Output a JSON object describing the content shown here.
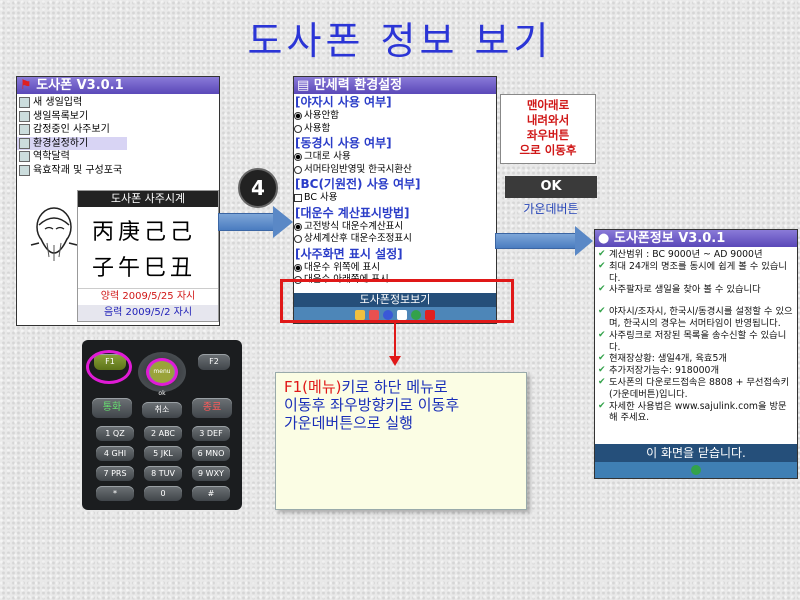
{
  "title": "도사폰 정보 보기",
  "step_number": "4",
  "screen1": {
    "titlebar": "도사폰 V3.0.1",
    "menu": [
      "새 생일입력",
      "생일목록보기",
      "감정중인 사주보기",
      "환경설정하기",
      "역학달력",
      "육효작괘 및 구성포국"
    ],
    "clock_title": "도사폰 사주시계",
    "saju_top": [
      "丙",
      "庚",
      "己",
      "己"
    ],
    "saju_bottom": [
      "子",
      "午",
      "巳",
      "丑"
    ],
    "solar": "양력 2009/5/25 자시",
    "lunar": "음력 2009/5/2 자시"
  },
  "screen2": {
    "titlebar": "만세력 환경설정",
    "sections": [
      {
        "header": "[야자시 사용 여부]",
        "options": [
          {
            "label": "사용안함",
            "type": "radio",
            "checked": true
          },
          {
            "label": "사용함",
            "type": "radio",
            "checked": false
          }
        ]
      },
      {
        "header": "[동경시 사용 여부]",
        "options": [
          {
            "label": "그대로 사용",
            "type": "radio",
            "checked": true
          },
          {
            "label": "서머타임반영및 한국시환산",
            "type": "radio",
            "checked": false
          }
        ]
      },
      {
        "header": "[BC(기원전) 사용 여부]",
        "options": [
          {
            "label": "BC 사용",
            "type": "check",
            "checked": false
          }
        ]
      },
      {
        "header": "[대운수 계산표시방법]",
        "options": [
          {
            "label": "고전방식 대운수계산표시",
            "type": "radio",
            "checked": true
          },
          {
            "label": "상세계산후 대운수조정표시",
            "type": "radio",
            "checked": false
          }
        ]
      },
      {
        "header": "[사주화면 표시 설정]",
        "options": [
          {
            "label": "대운수 위쪽에 표시",
            "type": "radio",
            "checked": true
          },
          {
            "label": "대운수 아래쪽에 표시",
            "type": "radio",
            "checked": false
          }
        ]
      }
    ],
    "bottom_menu": "도사폰정보보기"
  },
  "note_red": [
    "맨아래로",
    "내려와서",
    "좌우버튼",
    "으로 이동후"
  ],
  "ok_label": "OK",
  "ok_caption": "가운데버튼",
  "screen3": {
    "titlebar": "도사폰정보 V3.0.1",
    "items": [
      "계산범위 : BC 9000년 ~ AD 9000년",
      "최대 24개의 명조를 동시에 쉽게 볼 수 있습니다.",
      "사주팔자로 생일을 찾아 볼 수 있습니다",
      "",
      "야자시/조자시, 한국시/동경시를 설정할 수 있으며, 한국시의 경우는 서머타임이 반영됩니다.",
      "사주링크로 저장된 목록을 송수신할 수 있습니다.",
      "현재장상황: 생일4개, 육효5개",
      "추가저장가능수: 918000개",
      "도사폰의 다운로드접속은 8808 + 무선접속키(가운데버튼)입니다.",
      "자세한 사용법은 www.sajulink.com을 방문해 주세요."
    ],
    "close_button": "이 화면을 닫습니다."
  },
  "callout": {
    "line1_red": "F1(메뉴)",
    "line1_rest": "키로 하단 메뉴로",
    "line2": "이동후 좌우방향키로 이동후",
    "line3": "가운데버튼으로 실행"
  },
  "keypad": {
    "f1": "F1",
    "f2": "F2",
    "menu_ok": "menu ok",
    "call": "통화",
    "cancel": "취소",
    "end": "종료",
    "keys": [
      [
        "1 QZ",
        "2 ABC",
        "3 DEF"
      ],
      [
        "4 GHI",
        "5 JKL",
        "6 MNO"
      ],
      [
        "7 PRS",
        "8 TUV",
        "9 WXY"
      ],
      [
        "*",
        "0",
        "#"
      ]
    ]
  },
  "colors": {
    "accent_red": "#d01818",
    "title_blue": "#2b35d6",
    "callout_bg": "#fbfde4",
    "highlight_magenta": "#e01bd6"
  }
}
